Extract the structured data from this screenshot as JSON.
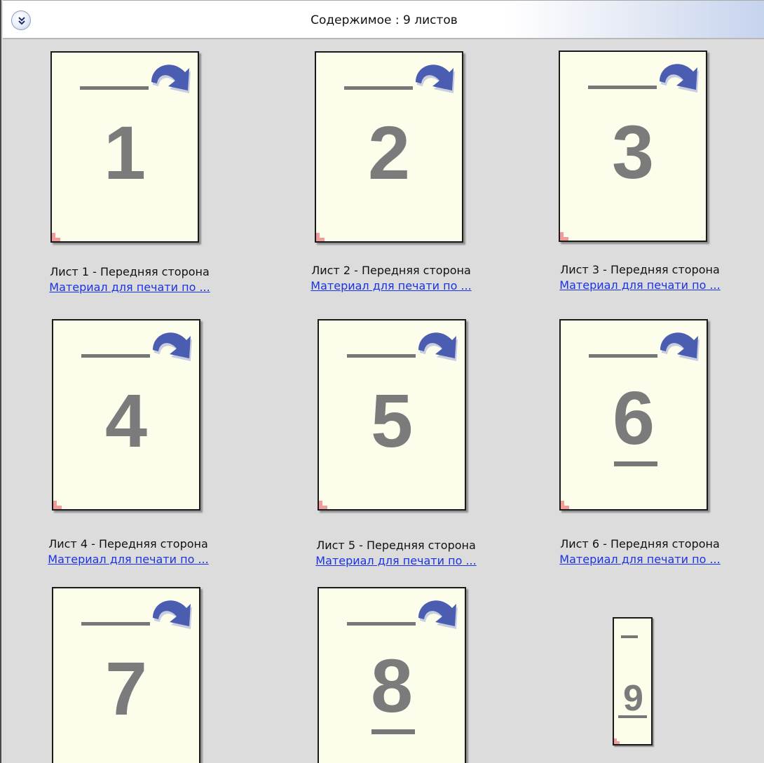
{
  "header": {
    "title": "Содержимое : 9 листов",
    "collapse_icon": "double-chevron-down-icon"
  },
  "sheets": [
    {
      "number": "1",
      "caption": "Лист 1 - Передняя сторона",
      "link": "Материал для печати по ..."
    },
    {
      "number": "2",
      "caption": "Лист 2 - Передняя сторона",
      "link": "Материал для печати по ..."
    },
    {
      "number": "3",
      "caption": "Лист 3 - Передняя сторона",
      "link": "Материал для печати по ..."
    },
    {
      "number": "4",
      "caption": "Лист 4 - Передняя сторона",
      "link": "Материал для печати по ..."
    },
    {
      "number": "5",
      "caption": "Лист 5 - Передняя сторона",
      "link": "Материал для печати по ..."
    },
    {
      "number": "6",
      "caption": "Лист 6 - Передняя сторона",
      "link": "Материал для печати по ..."
    },
    {
      "number": "7"
    },
    {
      "number": "8"
    },
    {
      "number": "9"
    }
  ],
  "colors": {
    "page_fill": "#fdfdec",
    "link": "#1a32e6",
    "corner_mark": "#f19b9b",
    "arrow": "#4a5db0"
  }
}
